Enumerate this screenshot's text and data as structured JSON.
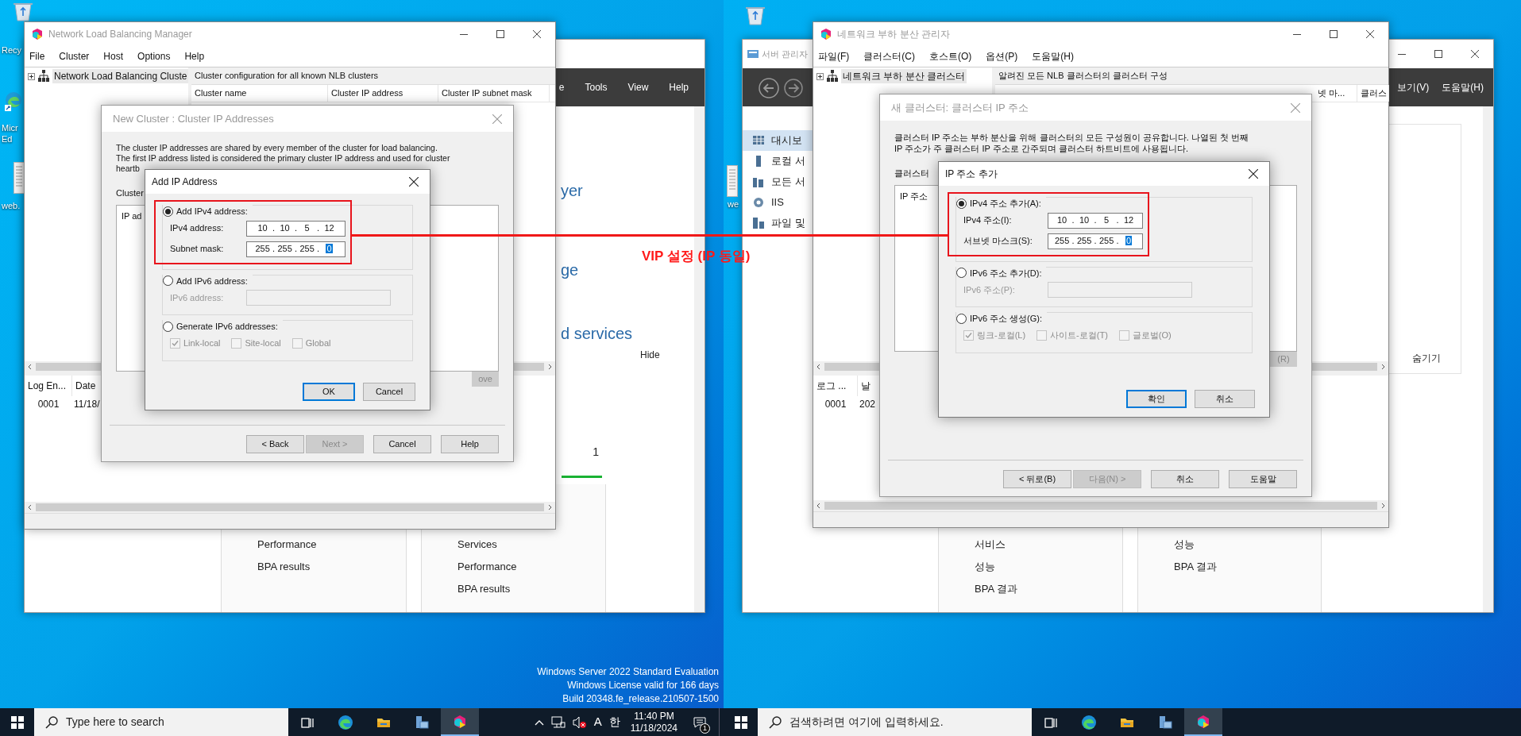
{
  "desktops": [
    {
      "desktop_icons": [
        {
          "lines": [
            "Recy"
          ]
        },
        {
          "lines": [
            "Micr",
            "Ed"
          ]
        },
        {
          "lines": [
            "web."
          ]
        }
      ],
      "server_manager": {
        "menu": [
          "e",
          "Tools",
          "View",
          "Help"
        ],
        "headings": [
          "yer",
          "ge",
          "d services"
        ],
        "hide": "Hide",
        "tile_count": "1",
        "columns": [
          [
            "Performance",
            "BPA results"
          ],
          [
            "Services",
            "Performance",
            "BPA results"
          ]
        ]
      },
      "nlb": {
        "title": "Network Load Balancing Manager",
        "menu": [
          "File",
          "Cluster",
          "Host",
          "Options",
          "Help"
        ],
        "tree_root": "Network Load Balancing Cluste",
        "info_header": "Cluster configuration for all known NLB clusters",
        "columns": [
          "Cluster name",
          "Cluster IP address",
          "Cluster IP subnet mask"
        ],
        "log_columns": [
          "Log En...",
          "Date"
        ],
        "log_rows": [
          [
            "0001",
            "11/18/"
          ]
        ]
      },
      "wizard": {
        "title": "New Cluster :  Cluster IP Addresses",
        "description": [
          "The cluster IP addresses are shared by every member of the cluster for load balancing.",
          "The first IP address listed is considered the primary cluster IP address and used for cluster",
          "heartb"
        ],
        "list_label": "Cluster",
        "list_header": "IP ad",
        "remove_button": {
          "label": "ove",
          "disabled": true
        },
        "buttons": [
          {
            "label": "< Back",
            "disabled": false
          },
          {
            "label": "Next >",
            "disabled": true
          },
          {
            "label": "Cancel",
            "disabled": false
          },
          {
            "label": "Help",
            "disabled": false
          }
        ]
      },
      "add_ip": {
        "title": "Add IP Address",
        "separator": ".",
        "groups": [
          {
            "label": "Add IPv4 address:",
            "selected": true,
            "highlighted": true,
            "fields": [
              {
                "label": "IPv4 address:",
                "disabled": false,
                "octets": [
                  {
                    "text": "10",
                    "selected": false
                  },
                  {
                    "text": "10",
                    "selected": false
                  },
                  {
                    "text": "5",
                    "selected": false
                  },
                  {
                    "text": "12",
                    "selected": false
                  }
                ]
              },
              {
                "label": "Subnet mask:",
                "disabled": false,
                "octets": [
                  {
                    "text": "255",
                    "selected": false
                  },
                  {
                    "text": "255",
                    "selected": false
                  },
                  {
                    "text": "255",
                    "selected": false
                  },
                  {
                    "text": "0",
                    "selected": true
                  }
                ]
              }
            ]
          },
          {
            "label": "Add IPv6 address:",
            "selected": false,
            "highlighted": false,
            "fields": [
              {
                "label": "IPv6 address:",
                "disabled": true
              }
            ]
          },
          {
            "label": "Generate IPv6 addresses:",
            "selected": false,
            "highlighted": false,
            "options": [
              {
                "label": "Link-local",
                "checked": true,
                "disabled": true
              },
              {
                "label": "Site-local",
                "checked": false,
                "disabled": true
              },
              {
                "label": "Global",
                "checked": false,
                "disabled": true
              }
            ]
          }
        ],
        "buttons": [
          {
            "label": "OK",
            "default": true
          },
          {
            "label": "Cancel",
            "default": false
          }
        ]
      },
      "os_notice": [
        "Windows Server 2022 Standard Evaluation",
        "Windows License valid for 166 days",
        "Build 20348.fe_release.210507-1500"
      ],
      "taskbar": {
        "search_placeholder": "Type here to search",
        "apps": [
          {
            "selected": false
          },
          {
            "selected": false
          },
          {
            "selected": false
          },
          {
            "selected": false
          },
          {
            "selected": true
          }
        ],
        "tray": {
          "input": "A",
          "ime": "한",
          "time": "11:40 PM",
          "date": "11/18/2024",
          "notifications": "1"
        }
      }
    },
    {
      "desktop_icons": [
        {
          "lines": [
            "we"
          ]
        }
      ],
      "server_manager": {
        "title": "서버 관리자",
        "menu": [
          "보기(V)",
          "도움말(H)"
        ],
        "sidebar": [
          {
            "label": "대시보",
            "selected": true
          },
          {
            "label": "로컬 서",
            "selected": false
          },
          {
            "label": "모든 서",
            "selected": false
          },
          {
            "label": "IIS",
            "selected": false
          },
          {
            "label": "파일 및",
            "selected": false
          }
        ],
        "hide": "숨기기",
        "columns": [
          [
            "서비스",
            "성능",
            "BPA 결과"
          ],
          [
            "성능",
            "BPA 결과"
          ]
        ]
      },
      "nlb": {
        "title": "네트워크 부하 분산 관리자",
        "menu": [
          "파일(F)",
          "클러스터(C)",
          "호스트(O)",
          "옵션(P)",
          "도움말(H)"
        ],
        "tree_root": "네트워크 부하 분산 클러스터",
        "info_header": "알려진 모든 NLB 클러스터의 클러스터 구성",
        "columns": [
          "넷 마...",
          "클러스"
        ],
        "log_columns": [
          "로그 ...",
          "날"
        ],
        "log_rows": [
          [
            "0001",
            "202"
          ]
        ]
      },
      "wizard": {
        "title": "새 클러스터: 클러스터 IP 주소",
        "description": [
          "클러스터 IP 주소는 부하 분산을 위해 클러스터의 모든 구성원이 공유합니다. 나열된 첫 번째",
          "IP 주소가 주 클러스터 IP 주소로 간주되며 클러스터 하트비트에 사용됩니다."
        ],
        "list_label": "클러스터",
        "list_header": "IP 주소",
        "remove_button": {
          "label": "(R)",
          "disabled": true
        },
        "buttons": [
          {
            "label": "< 뒤로(B)",
            "disabled": false
          },
          {
            "label": "다음(N) >",
            "disabled": true
          },
          {
            "label": "취소",
            "disabled": false
          },
          {
            "label": "도움말",
            "disabled": false
          }
        ]
      },
      "add_ip": {
        "title": "IP 주소 추가",
        "separator": ".",
        "groups": [
          {
            "label": "IPv4 주소 추가(A):",
            "selected": true,
            "highlighted": true,
            "fields": [
              {
                "label": "IPv4 주소(I):",
                "disabled": false,
                "octets": [
                  {
                    "text": "10",
                    "selected": false
                  },
                  {
                    "text": "10",
                    "selected": false
                  },
                  {
                    "text": "5",
                    "selected": false
                  },
                  {
                    "text": "12",
                    "selected": false
                  }
                ]
              },
              {
                "label": "서브넷 마스크(S):",
                "disabled": false,
                "octets": [
                  {
                    "text": "255",
                    "selected": false
                  },
                  {
                    "text": "255",
                    "selected": false
                  },
                  {
                    "text": "255",
                    "selected": false
                  },
                  {
                    "text": "0",
                    "selected": true
                  }
                ]
              }
            ]
          },
          {
            "label": "IPv6 주소 추가(D):",
            "selected": false,
            "highlighted": false,
            "fields": [
              {
                "label": "IPv6 주소(P):",
                "disabled": true
              }
            ]
          },
          {
            "label": "IPv6 주소 생성(G):",
            "selected": false,
            "highlighted": false,
            "options": [
              {
                "label": "링크-로컬(L)",
                "checked": true,
                "disabled": true
              },
              {
                "label": "사이트-로컬(T)",
                "checked": false,
                "disabled": true
              },
              {
                "label": "글로벌(O)",
                "checked": false,
                "disabled": true
              }
            ]
          }
        ],
        "buttons": [
          {
            "label": "확인",
            "default": true
          },
          {
            "label": "취소",
            "default": false
          }
        ]
      },
      "taskbar": {
        "search_placeholder": "검색하려면 여기에 입력하세요.",
        "apps": [
          {
            "selected": false
          },
          {
            "selected": false
          },
          {
            "selected": false
          },
          {
            "selected": false
          },
          {
            "selected": true
          }
        ]
      }
    }
  ],
  "annotation": {
    "label": "VIP 설정 (IP 동일)"
  }
}
